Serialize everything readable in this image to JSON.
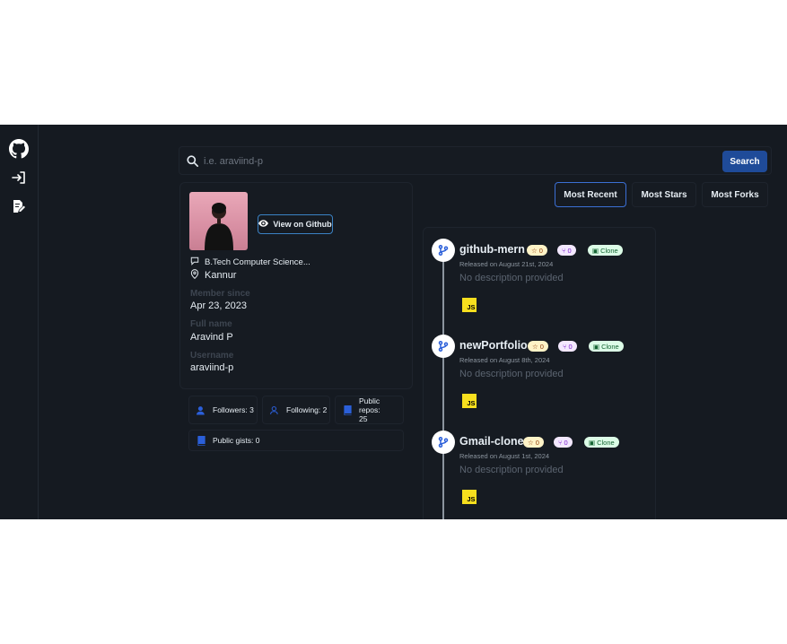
{
  "search": {
    "placeholder": "i.e. araviind-p",
    "button_label": "Search"
  },
  "sidebar": {
    "items": [
      {
        "icon": "github-icon"
      },
      {
        "icon": "login-icon"
      },
      {
        "icon": "signup-icon"
      }
    ]
  },
  "profile": {
    "view_button_label": "View on Github",
    "bio": "B.Tech Computer Science...",
    "location": "Kannur",
    "member_since_label": "Member since",
    "member_since": "Apr 23, 2023",
    "full_name_label": "Full name",
    "full_name": "Aravind P",
    "username_label": "Username",
    "username": "araviind-p"
  },
  "stats": {
    "followers": "Followers: 3",
    "following": "Following: 2",
    "public_repos_line1": "Public repos:",
    "public_repos_line2": "25",
    "public_gists": "Public gists: 0"
  },
  "sort": {
    "most_recent": "Most Recent",
    "most_stars": "Most Stars",
    "most_forks": "Most Forks",
    "active": "Most Recent"
  },
  "repos": [
    {
      "name": "github-mern",
      "stars": "0",
      "forks": "0",
      "clone_label": "Clone",
      "released": "Released on August 21st, 2024",
      "description": "No description provided",
      "language": "JS"
    },
    {
      "name": "newPortfolio",
      "stars": "0",
      "forks": "0",
      "clone_label": "Clone",
      "released": "Released on August 8th, 2024",
      "description": "No description provided",
      "language": "JS"
    },
    {
      "name": "Gmail-clone",
      "stars": "0",
      "forks": "0",
      "clone_label": "Clone",
      "released": "Released on August 1st, 2024",
      "description": "No description provided",
      "language": "JS"
    }
  ],
  "colors": {
    "background": "#151a21",
    "accent": "#1f4b99",
    "star_badge": "#fef3c7",
    "fork_badge": "#f3e8ff",
    "clone_badge": "#dcfce7",
    "js_yellow": "#f7df1e"
  }
}
